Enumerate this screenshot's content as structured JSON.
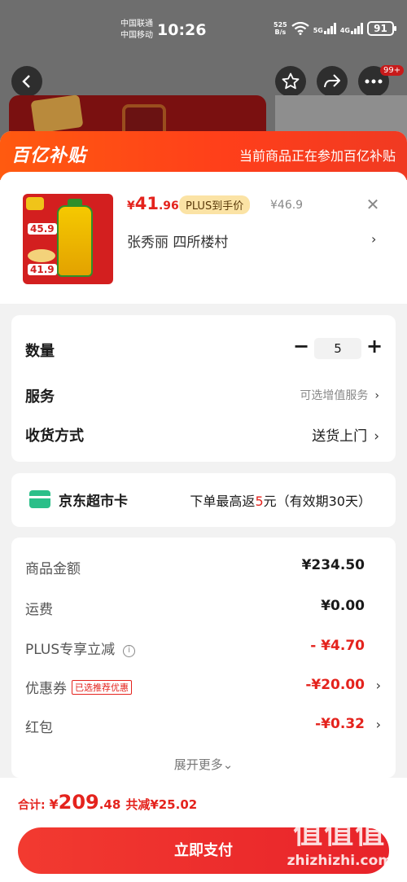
{
  "status": {
    "carrier1": "中国联通",
    "carrier2": "中国移动",
    "time": "10:26",
    "net_speed": "525",
    "net_unit": "B/s",
    "sig1": "5G",
    "sig2": "4G",
    "battery": "91"
  },
  "nav": {
    "badge": "99+"
  },
  "subsidy": {
    "logo": "百亿补贴",
    "text": "当前商品正在参加百亿补贴"
  },
  "product": {
    "price_yen": "¥",
    "price_int": "41",
    "price_dec": ".96",
    "plus_tag": "PLUS到手价",
    "orig_price": "¥46.9",
    "close": "✕",
    "address": "张秀丽  四所楼村",
    "img_tag1": "45.9",
    "img_tag2": "41.9"
  },
  "options": {
    "qty_label": "数量",
    "qty_minus": "−",
    "qty_value": "5",
    "qty_plus": "+",
    "service_label": "服务",
    "service_value": "可选增值服务",
    "delivery_label": "收货方式",
    "delivery_value": "送货上门",
    "chevron": "›"
  },
  "supercard": {
    "name": "京东超市卡",
    "desc_prefix": "下单最高返",
    "desc_amount": "5",
    "desc_suffix": "元（有效期30天）"
  },
  "fees": {
    "goods_label": "商品金额",
    "goods_value": "¥234.50",
    "shipping_label": "运费",
    "shipping_value": "¥0.00",
    "plus_label": "PLUS专享立减",
    "plus_value": "- ¥4.70",
    "coupon_label": "优惠券",
    "coupon_tag": "已选推荐优惠",
    "coupon_value": "-¥20.00",
    "redpacket_label": "红包",
    "redpacket_value": "-¥0.32",
    "expand": "展开更多⌄"
  },
  "footer": {
    "total_label": "合计: ",
    "total_yen": "¥",
    "total_int": "209",
    "total_dec": ".48",
    "saved": "共减¥25.02",
    "pay_button": "立即支付"
  },
  "watermark": {
    "big": "值值值",
    "site": "zhizhizhi.com"
  },
  "colors": {
    "accent_red": "#e4231d",
    "subsidy_orange": "#ff5a10",
    "plus_gold": "#fbe3a5"
  }
}
